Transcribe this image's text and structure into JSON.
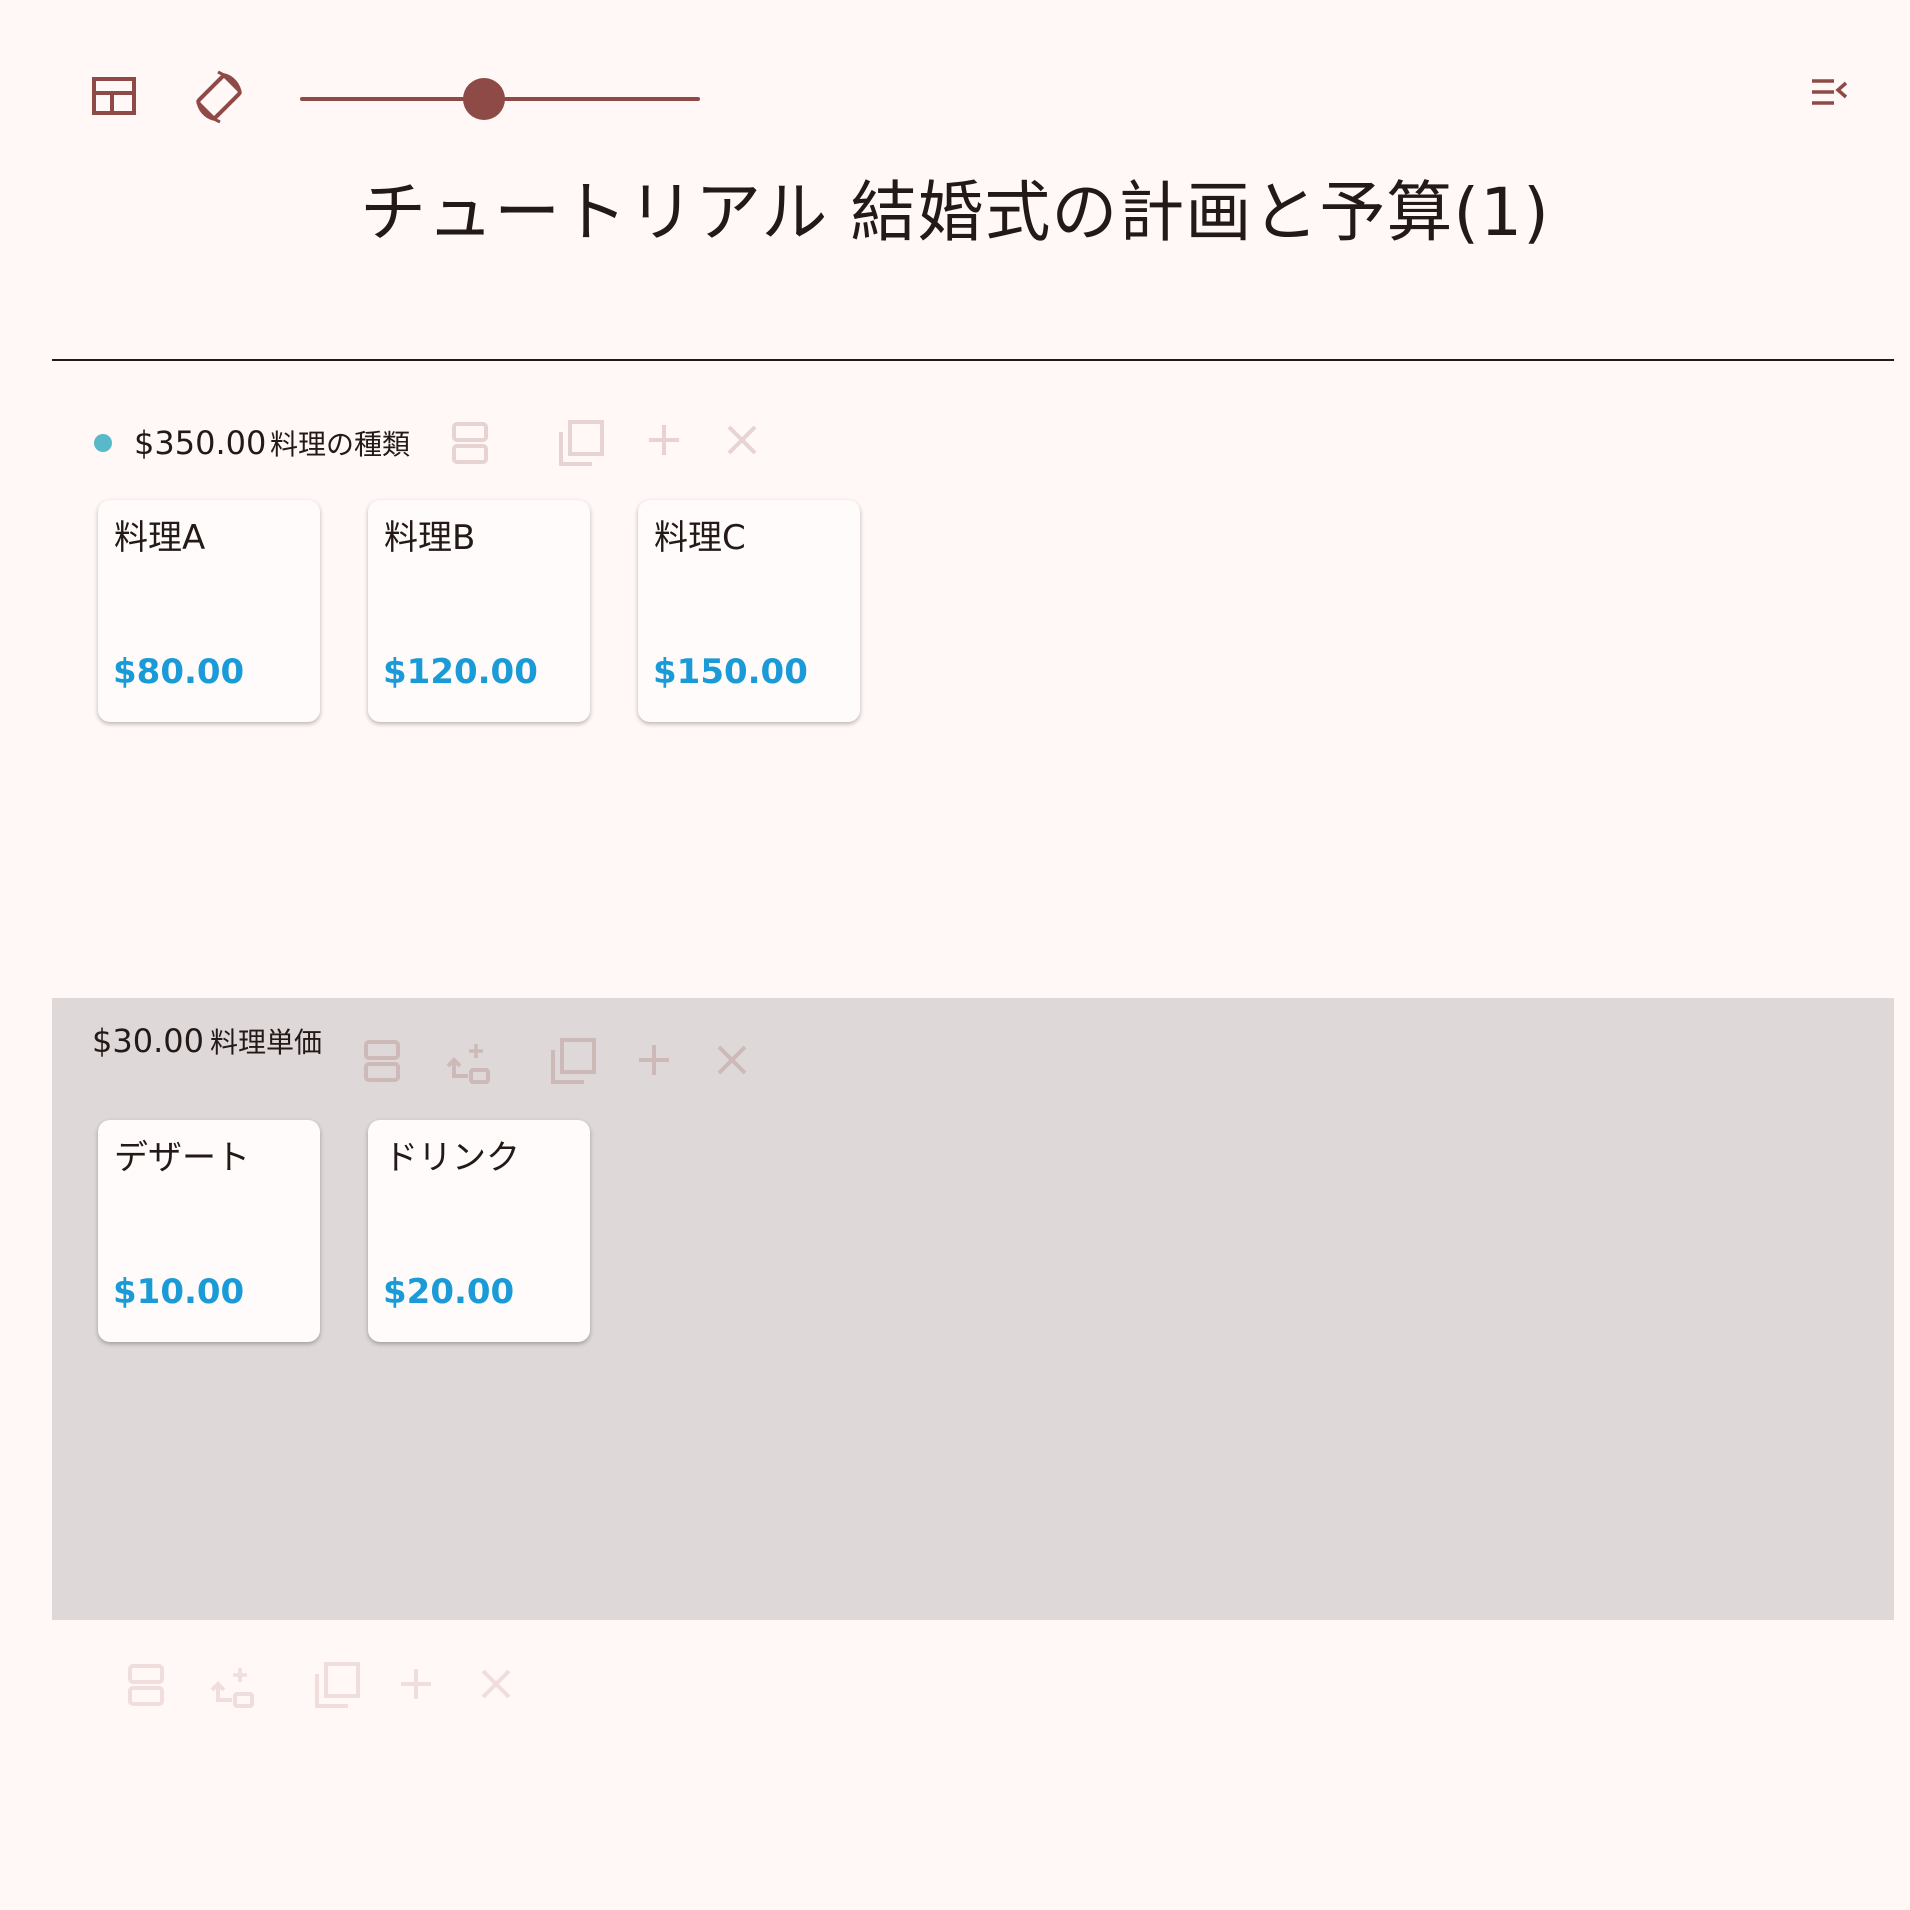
{
  "title": "チュートリアル 結婚式の計画と予算(1)",
  "zoom": {
    "value": 0.46
  },
  "colors": {
    "accent": "#8e4a46",
    "price": "#1a9ad6",
    "indicator": "#58b9c8",
    "selected_group_bg": "#ded8d8",
    "background": "#fff8f6"
  },
  "icons": {
    "layout": "layout-icon",
    "rotate": "rotate-icon",
    "outline": "outline-menu-icon",
    "split": "split-icon",
    "add_child": "add-child-icon",
    "copy": "copy-icon",
    "add": "plus-icon",
    "delete": "close-icon"
  },
  "groups": [
    {
      "total": "$350.00",
      "label": "料理の種類",
      "cards": [
        {
          "title": "料理A",
          "price": "$80.00"
        },
        {
          "title": "料理B",
          "price": "$120.00"
        },
        {
          "title": "料理C",
          "price": "$150.00"
        }
      ]
    },
    {
      "total": "$30.00",
      "label": "料理単価",
      "cards": [
        {
          "title": "デザート",
          "price": "$10.00"
        },
        {
          "title": "ドリンク",
          "price": "$20.00"
        }
      ]
    }
  ]
}
